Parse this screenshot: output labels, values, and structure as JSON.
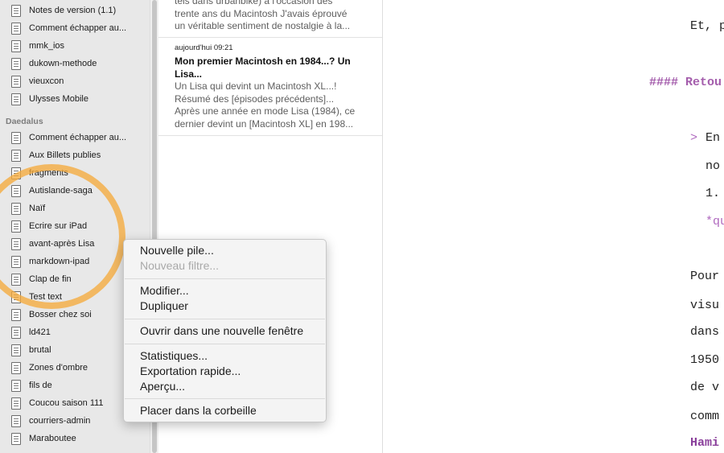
{
  "sidebar": {
    "items_top": [
      {
        "label": "Notes de version (1.1)"
      },
      {
        "label": "Comment échapper au..."
      },
      {
        "label": "mmk_ios"
      },
      {
        "label": "dukown-methode"
      },
      {
        "label": "vieuxcon"
      },
      {
        "label": "Ulysses Mobile"
      }
    ],
    "group_label": "Daedalus",
    "items_group": [
      {
        "label": "Comment échapper au..."
      },
      {
        "label": "Aux Billets publies"
      },
      {
        "label": "fragments"
      },
      {
        "label": "Autislande-saga"
      },
      {
        "label": "Naïf"
      },
      {
        "label": "Ecrire sur iPad"
      },
      {
        "label": "avant-après Lisa"
      },
      {
        "label": "markdown-ipad"
      },
      {
        "label": "Clap de fin"
      },
      {
        "label": "Test text"
      },
      {
        "label": "Bosser chez soi"
      },
      {
        "label": "ld421"
      },
      {
        "label": "brutal"
      },
      {
        "label": "Zones d'ombre"
      },
      {
        "label": "fils de"
      },
      {
        "label": "Coucou saison 111"
      },
      {
        "label": "courriers-admin"
      },
      {
        "label": "Maraboutee"
      }
    ]
  },
  "sheets": [
    {
      "lines": [
        "tels dans urbanbike) à l'occasion des",
        "trente ans du Macintosh J'avais éprouvé",
        "un véritable sentiment de nostalgie à la..."
      ]
    },
    {
      "date": "aujourd'hui 09:21",
      "title_1": "Mon premier Macintosh en 1984...? Un",
      "title_2": "Lisa...",
      "lines": [
        "Un Lisa qui devint un Macintosh XL...!",
        "Résumé des [épisodes précédents]...",
        "Après une année en mode Lisa (1984), ce",
        "dernier devint un [Macintosh XL] en 198..."
      ]
    }
  ],
  "editor": {
    "l1": "Et, p",
    "heading": "#### Retou",
    "q_mark": ">",
    "q1": "En",
    "q2": "no",
    "q3": "1.",
    "q4": "*qu",
    "p1": "Pour",
    "p2": "visu",
    "p3": "dans",
    "p4": "1950",
    "p5": "de v",
    "p6": "comm",
    "p7": "Hami"
  },
  "context_menu": {
    "new_stack": "Nouvelle pile...",
    "new_filter": "Nouveau filtre...",
    "edit": "Modifier...",
    "duplicate": "Dupliquer",
    "open_new_window": "Ouvrir dans une nouvelle fenêtre",
    "statistics": "Statistiques...",
    "quick_export": "Exportation rapide...",
    "preview": "Aperçu...",
    "trash": "Placer dans la corbeille"
  },
  "colors": {
    "accent_highlight": "#f5aa3c",
    "markdown_heading": "#a45dac"
  }
}
